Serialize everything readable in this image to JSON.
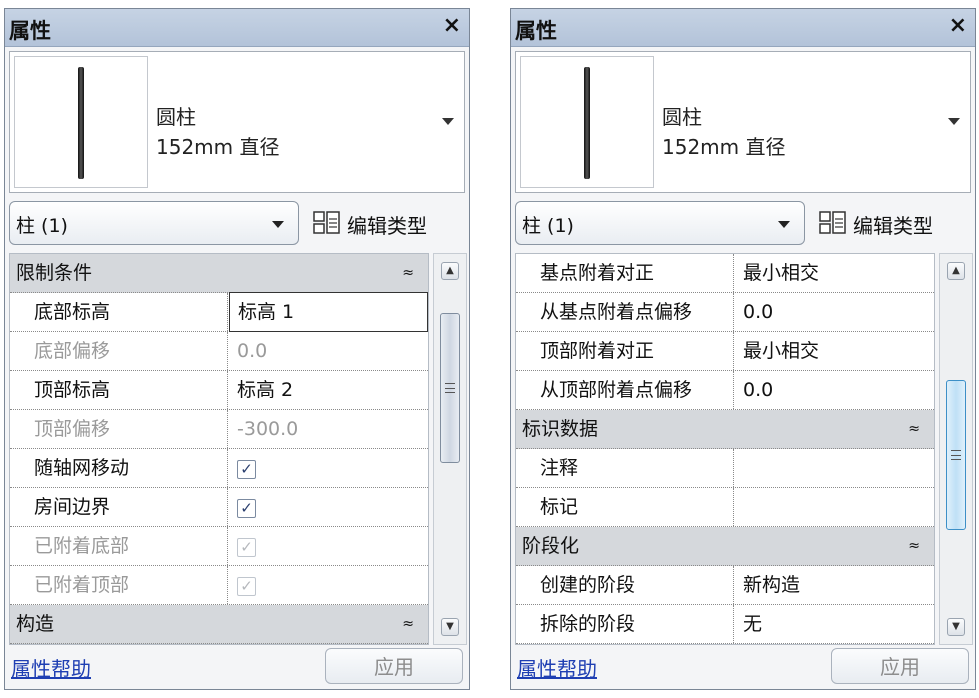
{
  "left": {
    "title": "属性",
    "close_glyph": "×",
    "type_name_line1": "圆柱",
    "type_name_line2": "152mm 直径",
    "filter": "柱 (1)",
    "edit_type_label": "编辑类型",
    "rows": [
      {
        "kind": "group",
        "label": "限制条件",
        "collapse": "≈"
      },
      {
        "kind": "prop",
        "name": "底部标高",
        "value": "标高 1",
        "editing": true
      },
      {
        "kind": "prop",
        "name": "底部偏移",
        "value": "0.0",
        "dim": true
      },
      {
        "kind": "prop",
        "name": "顶部标高",
        "value": "标高 2"
      },
      {
        "kind": "prop",
        "name": "顶部偏移",
        "value": "-300.0",
        "dim": true
      },
      {
        "kind": "check",
        "name": "随轴网移动",
        "checked": true
      },
      {
        "kind": "check",
        "name": "房间边界",
        "checked": true
      },
      {
        "kind": "check",
        "name": "已附着底部",
        "checked": true,
        "dim": true
      },
      {
        "kind": "check",
        "name": "已附着顶部",
        "checked": true,
        "dim": true
      },
      {
        "kind": "group",
        "label": "构造",
        "collapse": "≈"
      }
    ],
    "help_link": "属性帮助",
    "apply_label": "应用"
  },
  "right": {
    "title": "属性",
    "close_glyph": "×",
    "type_name_line1": "圆柱",
    "type_name_line2": "152mm 直径",
    "filter": "柱 (1)",
    "edit_type_label": "编辑类型",
    "rows": [
      {
        "kind": "prop",
        "name": "基点附着对正",
        "value": "最小相交"
      },
      {
        "kind": "prop",
        "name": "从基点附着点偏移",
        "value": "0.0"
      },
      {
        "kind": "prop",
        "name": "顶部附着对正",
        "value": "最小相交"
      },
      {
        "kind": "prop",
        "name": "从顶部附着点偏移",
        "value": "0.0"
      },
      {
        "kind": "group",
        "label": "标识数据",
        "collapse": "≈"
      },
      {
        "kind": "prop",
        "name": "注释",
        "value": ""
      },
      {
        "kind": "prop",
        "name": "标记",
        "value": ""
      },
      {
        "kind": "group",
        "label": "阶段化",
        "collapse": "≈"
      },
      {
        "kind": "prop",
        "name": "创建的阶段",
        "value": "新构造"
      },
      {
        "kind": "prop",
        "name": "拆除的阶段",
        "value": "无"
      }
    ],
    "help_link": "属性帮助",
    "apply_label": "应用"
  },
  "scroll": {
    "left_position": 0.15,
    "right_position": 0.55
  }
}
